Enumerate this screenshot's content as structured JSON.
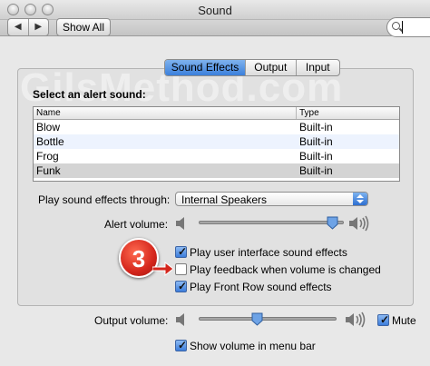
{
  "window": {
    "title": "Sound"
  },
  "toolbar": {
    "back_label": "◀",
    "forward_label": "▶",
    "show_all_label": "Show All",
    "search_placeholder": ""
  },
  "tabs": [
    {
      "label": "Sound Effects",
      "active": true
    },
    {
      "label": "Output",
      "active": false
    },
    {
      "label": "Input",
      "active": false
    }
  ],
  "watermark": "GilsMethod.com",
  "alert": {
    "heading": "Select an alert sound:",
    "columns": {
      "name": "Name",
      "type": "Type"
    },
    "rows": [
      {
        "name": "Blow",
        "type": "Built-in"
      },
      {
        "name": "Bottle",
        "type": "Built-in"
      },
      {
        "name": "Frog",
        "type": "Built-in"
      },
      {
        "name": "Funk",
        "type": "Built-in",
        "selected": true
      }
    ]
  },
  "effects_through": {
    "label": "Play sound effects through:",
    "value": "Internal Speakers"
  },
  "alert_volume": {
    "label": "Alert volume:",
    "level": 0.92
  },
  "checkboxes": {
    "ui_effects": {
      "label": "Play user interface sound effects",
      "checked": true
    },
    "feedback": {
      "label": "Play feedback when volume is changed",
      "checked": false
    },
    "front_row": {
      "label": "Play Front Row sound effects",
      "checked": true
    }
  },
  "callout": {
    "number": "3"
  },
  "output_volume": {
    "label": "Output volume:",
    "level": 0.42,
    "mute_label": "Mute",
    "mute_checked": true
  },
  "menu_bar": {
    "label": "Show volume in menu bar",
    "checked": true
  },
  "colors": {
    "accent": "#3b7fdb",
    "callout": "#d4261c",
    "selection": "#d4d4d4"
  }
}
